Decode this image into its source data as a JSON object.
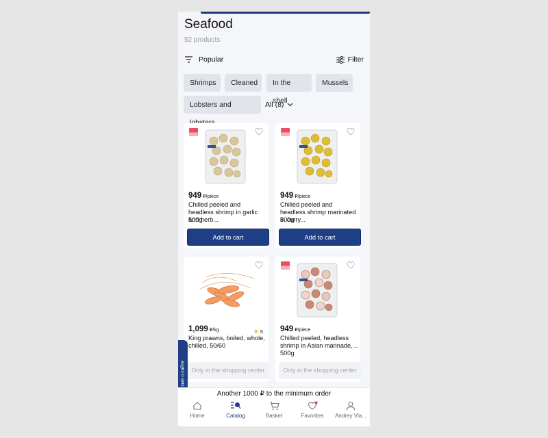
{
  "header": {
    "title": "Seafood",
    "count": "52 products"
  },
  "toolbar": {
    "sort_label": "Popular",
    "filter_label": "Filter"
  },
  "chips": [
    "Shrimps",
    "Cleaned",
    "In the shell",
    "Mussels",
    "Lobsters and lobsters"
  ],
  "all_label": "All (8)",
  "products": [
    {
      "price": "949",
      "unit": "₽/piece",
      "name": "Chilled peeled and headless shrimp in garlic and herb...",
      "weight": "500g",
      "button": "Add to cart"
    },
    {
      "price": "949",
      "unit": "₽/piece",
      "name": "Chilled peeled and headless shrimp marinated in curry...",
      "weight": "500g",
      "button": "Add to cart"
    },
    {
      "price": "1,099",
      "unit": "₽/kg",
      "name": "King prawns, boiled, whole, chilled, 50/60",
      "rating": "5",
      "button": "Only in the shopping center"
    },
    {
      "price": "949",
      "unit": "₽/piece",
      "name": "Chilled peeled, headless shrimp in Asian marinade,...",
      "weight": "500g",
      "button": "Only in the shopping center"
    }
  ],
  "min_order": "Another 1000 ₽ to the minimum order",
  "feedback_tab": "Отзыв о сайте",
  "nav": {
    "home": "Home",
    "catalog": "Catalog",
    "basket": "Basket",
    "favorites": "Favorites",
    "profile": "Andrey Vla..."
  },
  "colors": {
    "accent": "#1e3f85",
    "badge": "#ee4d5d",
    "background": "#f4f6f9"
  }
}
